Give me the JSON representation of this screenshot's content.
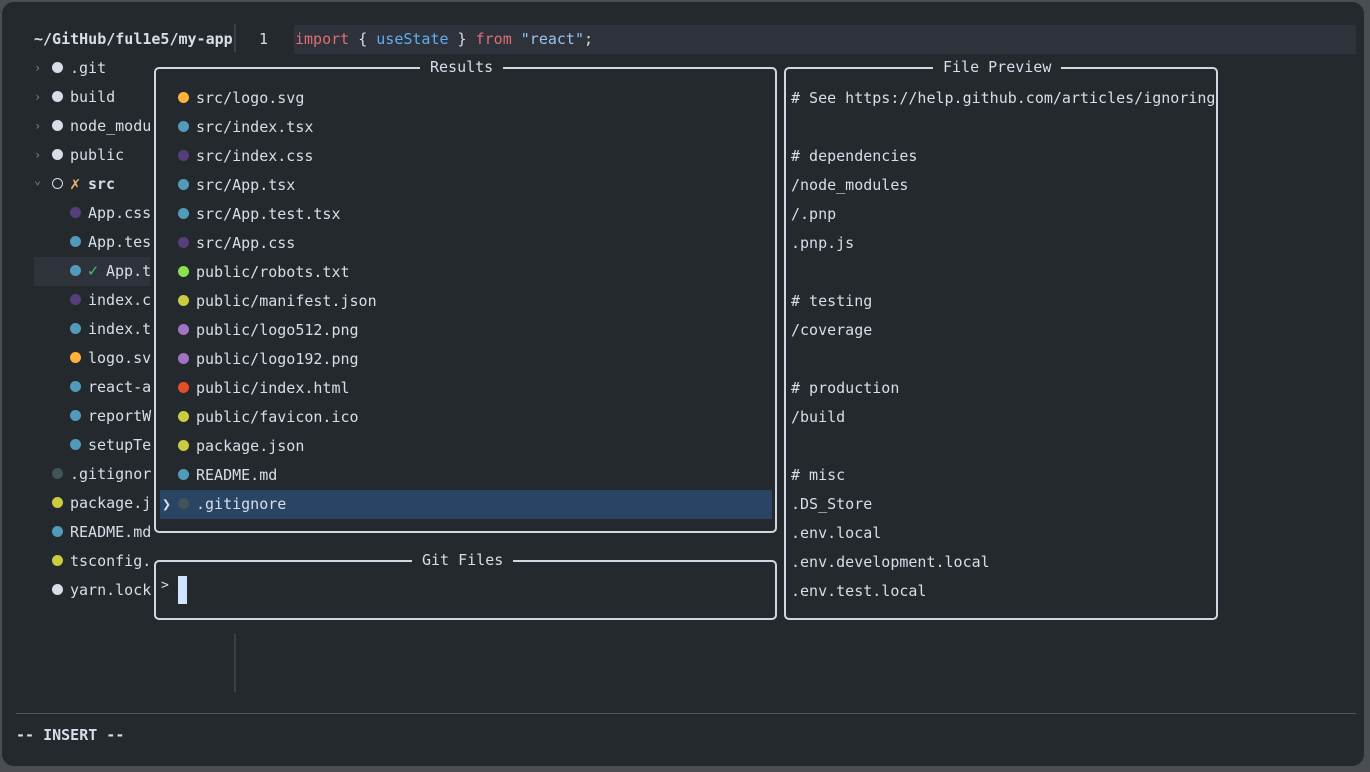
{
  "explorer": {
    "root": "~/GitHub/ful1e5/my-app",
    "items": [
      {
        "label": ".git",
        "type": "folder",
        "expanded": false,
        "color": "#d8dee9",
        "indent": 0
      },
      {
        "label": "build",
        "type": "folder",
        "expanded": false,
        "color": "#d8dee9",
        "indent": 0
      },
      {
        "label": "node_modu",
        "type": "folder",
        "expanded": false,
        "color": "#d8dee9",
        "indent": 0
      },
      {
        "label": "public",
        "type": "folder",
        "expanded": false,
        "color": "#d8dee9",
        "indent": 0
      },
      {
        "label": "src",
        "type": "folder",
        "expanded": true,
        "git_status": "✗",
        "color": "#d8dee9",
        "indent": 0
      },
      {
        "label": "App.css",
        "type": "file",
        "color": "#563d7c",
        "indent": 1
      },
      {
        "label": "App.tes",
        "type": "file",
        "color": "#519aba",
        "indent": 1
      },
      {
        "label": "App.t",
        "type": "file",
        "color": "#519aba",
        "indent": 1,
        "git_status": "✓",
        "selected": true
      },
      {
        "label": "index.c",
        "type": "file",
        "color": "#563d7c",
        "indent": 1
      },
      {
        "label": "index.t",
        "type": "file",
        "color": "#519aba",
        "indent": 1
      },
      {
        "label": "logo.sv",
        "type": "file",
        "color": "#ffb13b",
        "indent": 1
      },
      {
        "label": "react-a",
        "type": "file",
        "color": "#519aba",
        "indent": 1
      },
      {
        "label": "reportW",
        "type": "file",
        "color": "#519aba",
        "indent": 1
      },
      {
        "label": "setupTe",
        "type": "file",
        "color": "#519aba",
        "indent": 1
      },
      {
        "label": ".gitignor",
        "type": "file",
        "color": "#41535b",
        "indent": 0
      },
      {
        "label": "package.j",
        "type": "file",
        "color": "#cbcb41",
        "indent": 0
      },
      {
        "label": "README.md",
        "type": "file",
        "color": "#519aba",
        "indent": 0
      },
      {
        "label": "tsconfig.",
        "type": "file",
        "color": "#cbcb41",
        "indent": 0
      },
      {
        "label": "yarn.lock",
        "type": "file",
        "color": "#d8dee9",
        "indent": 0
      }
    ]
  },
  "editor": {
    "line_number": "1",
    "tokens": [
      {
        "text": "import",
        "cls": "kw"
      },
      {
        "text": " { ",
        "cls": "pun"
      },
      {
        "text": "useState",
        "cls": "fn"
      },
      {
        "text": " } ",
        "cls": "pun"
      },
      {
        "text": "from",
        "cls": "kw"
      },
      {
        "text": " ",
        "cls": "pun"
      },
      {
        "text": "\"react\"",
        "cls": "str"
      },
      {
        "text": ";",
        "cls": "pun"
      }
    ]
  },
  "results": {
    "title": "Results",
    "items": [
      {
        "label": "src/logo.svg",
        "color": "#ffb13b"
      },
      {
        "label": "src/index.tsx",
        "color": "#519aba"
      },
      {
        "label": "src/index.css",
        "color": "#563d7c"
      },
      {
        "label": "src/App.tsx",
        "color": "#519aba"
      },
      {
        "label": "src/App.test.tsx",
        "color": "#519aba"
      },
      {
        "label": "src/App.css",
        "color": "#563d7c"
      },
      {
        "label": "public/robots.txt",
        "color": "#89e051"
      },
      {
        "label": "public/manifest.json",
        "color": "#cbcb41"
      },
      {
        "label": "public/logo512.png",
        "color": "#a074c4"
      },
      {
        "label": "public/logo192.png",
        "color": "#a074c4"
      },
      {
        "label": "public/index.html",
        "color": "#e44d26"
      },
      {
        "label": "public/favicon.ico",
        "color": "#cbcb41"
      },
      {
        "label": "package.json",
        "color": "#cbcb41"
      },
      {
        "label": "README.md",
        "color": "#519aba"
      },
      {
        "label": ".gitignore",
        "color": "#41535b",
        "selected": true
      }
    ],
    "selection_caret": "❯"
  },
  "prompt": {
    "title": "Git Files",
    "prefix": ">",
    "value": ""
  },
  "preview": {
    "title": "File Preview",
    "lines": [
      "# See https://help.github.com/articles/ignoring",
      "",
      "# dependencies",
      "/node_modules",
      "/.pnp",
      ".pnp.js",
      "",
      "# testing",
      "/coverage",
      "",
      "# production",
      "/build",
      "",
      "# misc",
      ".DS_Store",
      ".env.local",
      ".env.development.local",
      ".env.test.local"
    ]
  },
  "status": {
    "mode": "-- INSERT --"
  }
}
